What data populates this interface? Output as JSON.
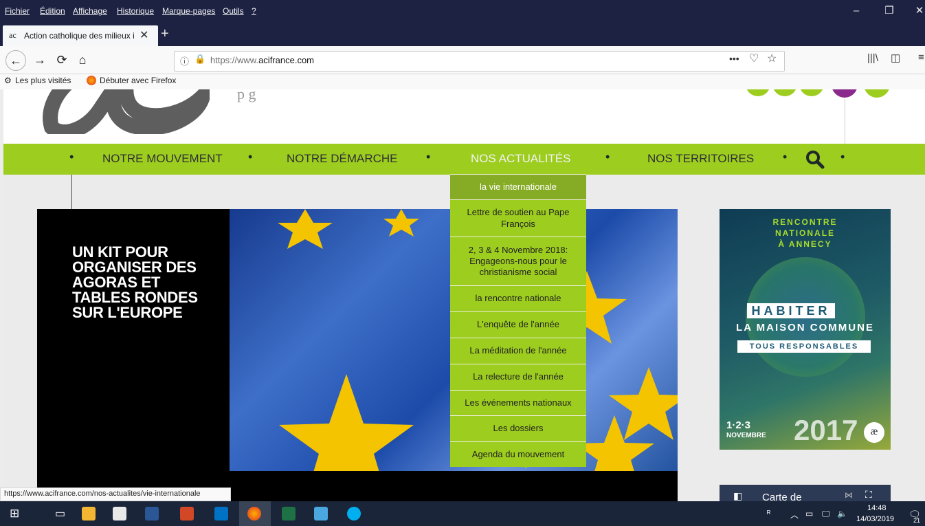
{
  "menubar": {
    "items": [
      "Fichier",
      "Édition",
      "Affichage",
      "Historique",
      "Marque-pages",
      "Outils",
      "?"
    ]
  },
  "tab": {
    "title": "Action catholique des milieux i",
    "favicon": "ac"
  },
  "urlbar": {
    "url_prefix": "https://www.",
    "url_domain": "acifrance.com"
  },
  "bookmarks": {
    "items": [
      "Les plus visités",
      "Débuter avec Firefox"
    ]
  },
  "site": {
    "nav": [
      "NOTRE MOUVEMENT",
      "NOTRE DÉMARCHE",
      "NOS ACTUALITÉS",
      "NOS TERRITOIRES"
    ],
    "dropdown": [
      "la vie internationale",
      "Lettre de soutien au Pape François",
      "2, 3 & 4 Novembre 2018: Engageons-nous pour le christianisme social",
      "la rencontre nationale",
      "L'enquête de l'année",
      "La méditation de l'année",
      "La relecture de l'année",
      "Les événements nationaux",
      "Les dossiers",
      "Agenda du mouvement"
    ],
    "hero_title": "UN KIT POUR ORGANISER DES AGORAS ET TABLES RONDES SUR L'EUROPE",
    "poster": {
      "line1": "RENCONTRE",
      "line2": "NATIONALE",
      "line3": "À ANNECY",
      "habiter": "HABITER",
      "maison": "LA MAISON COMMUNE",
      "tous": "TOUS RESPONSABLES",
      "days": "1·2·3",
      "month": "NOVEMBRE",
      "year": "2017"
    },
    "sidebar_card": "Carte de"
  },
  "status_url": "https://www.acifrance.com/nos-actualites/vie-internationale",
  "taskbar": {
    "time": "14:48",
    "date": "14/03/2019",
    "notif": "21"
  },
  "colors": {
    "accent_green": "#9dcd1f",
    "browser_dark": "#1d2243"
  }
}
